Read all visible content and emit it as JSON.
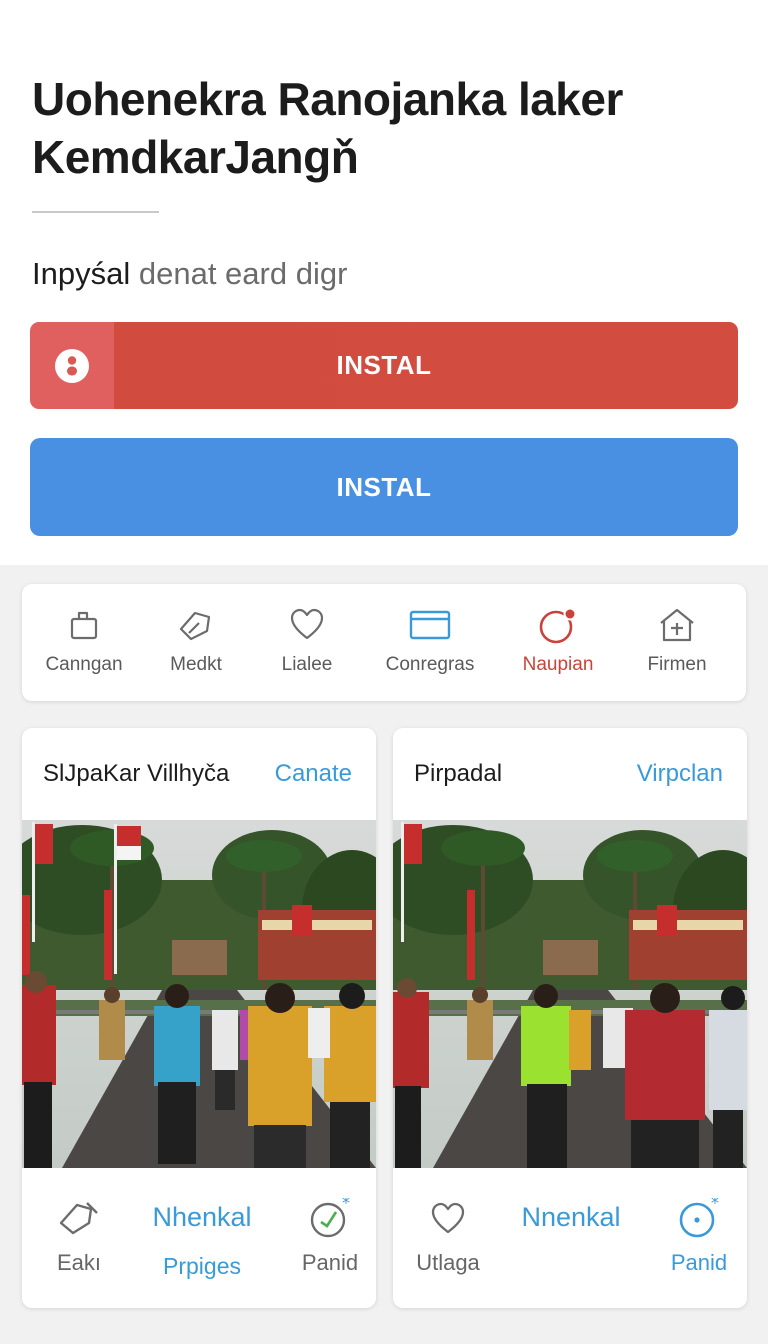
{
  "header": {
    "title_line1": "Uohenekra Ranojanka laker",
    "title_line2": "KemdkarJangň",
    "subtitle_strong": "Inpyśal",
    "subtitle_rest": "denat eard digr"
  },
  "buttons": {
    "install_red_label": "INSTAL",
    "install_blue_label": "INSTAL"
  },
  "nav": {
    "items": [
      {
        "label": "Canngan",
        "icon": "bag-icon"
      },
      {
        "label": "Medkt",
        "icon": "tag-icon"
      },
      {
        "label": "Lialee",
        "icon": "heart-icon"
      },
      {
        "label": "Conregras",
        "icon": "card-icon"
      },
      {
        "label": "Naupian",
        "icon": "notification-icon"
      },
      {
        "label": "Firmen",
        "icon": "home-icon"
      }
    ],
    "active_index": 4
  },
  "cards": [
    {
      "title": "SlJpaKar Villhyča",
      "link": "Canate",
      "footer": {
        "left_label": "Eakı",
        "mid_heading": "Nhenkal",
        "mid_label": "Prpiges",
        "right_label": "Panid"
      }
    },
    {
      "title": "Pirpadal",
      "link": "Virpclan",
      "footer": {
        "left_label": "Utlaga",
        "mid_heading": "Nnenkal",
        "right_label": "Panid"
      }
    }
  ],
  "colors": {
    "red": "#d34c40",
    "blue": "#4a90e2",
    "link_blue": "#3a9ad9",
    "active_red": "#c9433a"
  }
}
